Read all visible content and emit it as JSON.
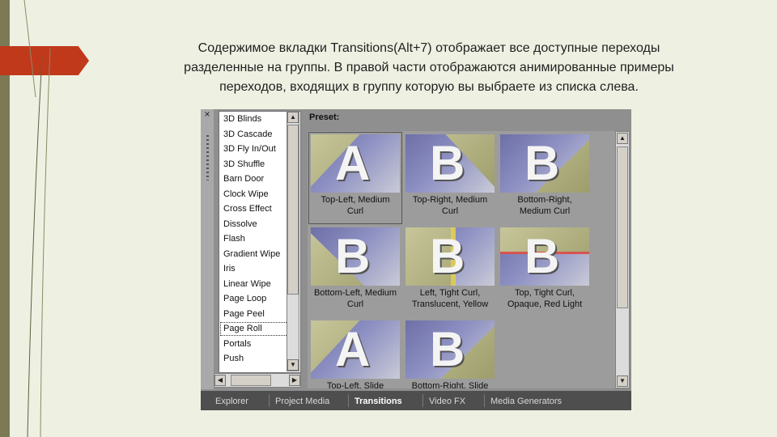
{
  "caption": {
    "lines": [
      "Содержимое вкладки Transitions(Alt+7) отображает все доступные переходы",
      "разделенные на группы. В правой части отображаются анимированные примеры",
      "переходов, входящих в группу которую вы выбраете из списка слева."
    ]
  },
  "panel": {
    "close_glyph": "×",
    "preset_label": "Preset:",
    "transitions": [
      "3D Blinds",
      "3D Cascade",
      "3D Fly In/Out",
      "3D Shuffle",
      "Barn Door",
      "Clock Wipe",
      "Cross Effect",
      "Dissolve",
      "Flash",
      "Gradient Wipe",
      "Iris",
      "Linear Wipe",
      "Page Loop",
      "Page Peel",
      "Page Roll",
      "Portals",
      "Push"
    ],
    "selected_transition": "Page Roll",
    "presets": [
      {
        "line1": "Top-Left, Medium",
        "line2": "Curl",
        "glyph": "A"
      },
      {
        "line1": "Top-Right, Medium",
        "line2": "Curl",
        "glyph": "B"
      },
      {
        "line1": "Bottom-Right,",
        "line2": "Medium Curl",
        "glyph": "B"
      },
      {
        "line1": "Bottom-Left, Medium",
        "line2": "Curl",
        "glyph": "B"
      },
      {
        "line1": "Left, Tight Curl,",
        "line2": "Translucent, Yellow",
        "glyph": "B"
      },
      {
        "line1": "Top, Tight Curl,",
        "line2": "Opaque, Red Light",
        "glyph": "B"
      },
      {
        "line1": "Top-Left, Slide",
        "line2": "",
        "glyph": "A"
      },
      {
        "line1": "Bottom-Right, Slide",
        "line2": "",
        "glyph": "B"
      }
    ],
    "selected_preset_index": 0
  },
  "tabs": [
    {
      "label": "Explorer",
      "active": false
    },
    {
      "label": "Project Media",
      "active": false
    },
    {
      "label": "Transitions",
      "active": true
    },
    {
      "label": "Video FX",
      "active": false
    },
    {
      "label": "Media Generators",
      "active": false
    }
  ],
  "colors": {
    "slide_background": "#eef1e2",
    "accent_red": "#c1391b",
    "left_band": "#7b7a55",
    "tab_bar": "#4e4e4e"
  },
  "icons": {
    "close": "close-icon",
    "scroll_up": "arrow-up-icon",
    "scroll_down": "arrow-down-icon",
    "scroll_left": "arrow-left-icon",
    "scroll_right": "arrow-right-icon",
    "grip": "grip-icon"
  }
}
